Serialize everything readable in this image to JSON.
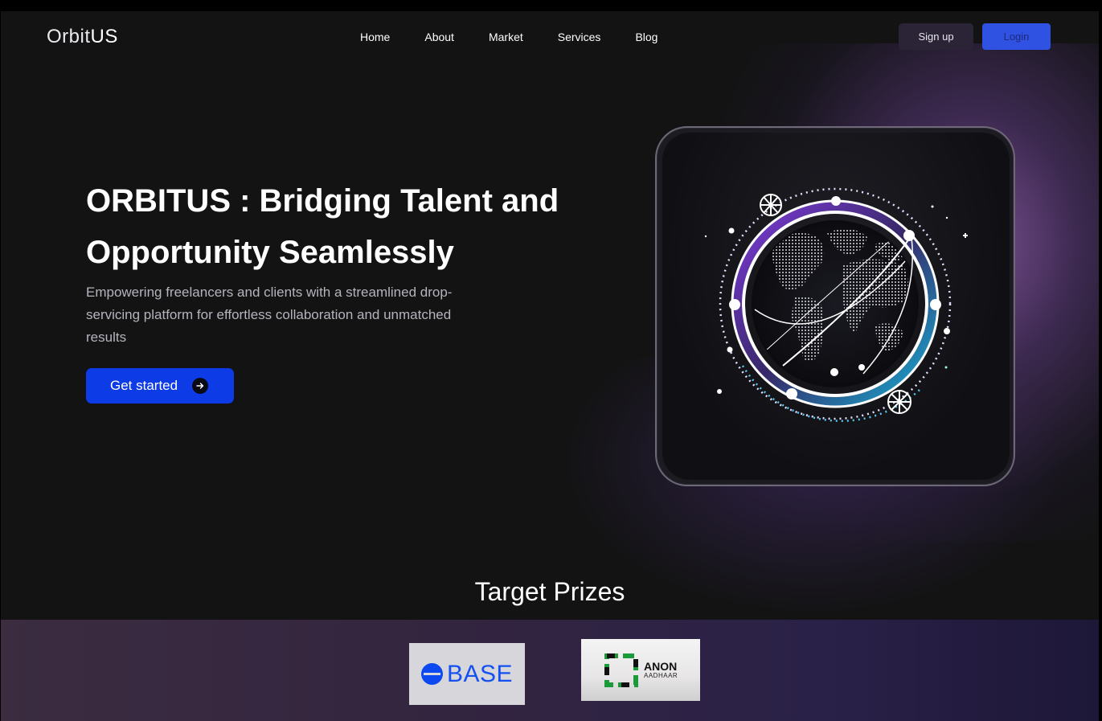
{
  "brand": {
    "name_part1": "Orbit",
    "name_part2": "US"
  },
  "nav": {
    "items": [
      "Home",
      "About",
      "Market",
      "Services",
      "Blog"
    ]
  },
  "auth": {
    "signup_label": "Sign up",
    "login_label": "Login"
  },
  "hero": {
    "title": "ORBITUS : Bridging Talent and Opportunity Seamlessly",
    "subtitle": "Empowering freelancers and clients with a streamlined drop-servicing platform for effortless collaboration and unmatched results",
    "cta_label": "Get started"
  },
  "prizes": {
    "title": "Target Prizes",
    "sponsors": [
      {
        "name": "BASE"
      },
      {
        "name": "ANON",
        "tagline": "AADHAAR"
      }
    ]
  },
  "colors": {
    "background": "#131314",
    "primary": "#0d3be6",
    "login_button": "#2f52e3",
    "signup_button": "#2a2436",
    "accent_glow": "#8e5caa"
  },
  "icons": {
    "cta_arrow": "arrow-right-icon",
    "hero_image": "globe-orbit-illustration"
  }
}
